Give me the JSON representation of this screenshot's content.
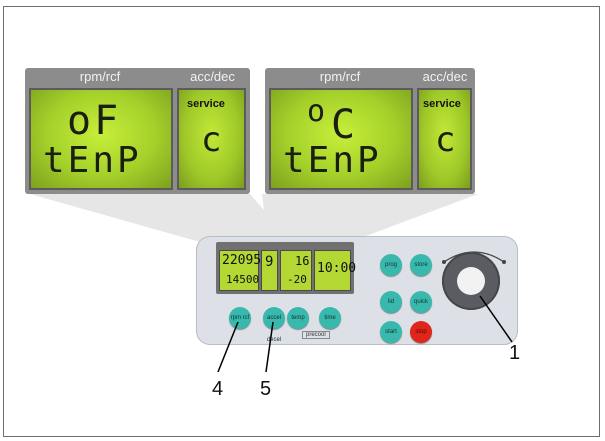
{
  "panel_left": {
    "header_main": "rpm/rcf",
    "header_side": "acc/dec",
    "line1": "oF",
    "line2": "tEnP",
    "side_label": "service",
    "side_value": "c"
  },
  "panel_right": {
    "header_main": "rpm/rcf",
    "header_side": "acc/dec",
    "line1_a": "o",
    "line1_b": "C",
    "line2": "tEnP",
    "side_label": "service",
    "side_value": "c"
  },
  "device": {
    "lcd": {
      "speed_top": "22095",
      "speed_bottom": "14500",
      "accdec": "9",
      "temp_top": "16",
      "temp_bottom": "-20",
      "time": "10:00"
    },
    "buttons": {
      "rpm_rcf": "rpm rcf",
      "accel_decel": "accel decel",
      "temp": "temp",
      "time": "time",
      "prog": "prog",
      "store": "store",
      "lid": "lid",
      "quick": "quick",
      "start": "start",
      "stop": "stop",
      "precool": "precool"
    }
  },
  "callouts": {
    "knob": "1",
    "rpm_button": "4",
    "accel_button": "5"
  },
  "colors": {
    "lcd_green": "#b4d833",
    "button_teal": "#39b9ad",
    "stop_red": "#e0261a",
    "panel_gray": "#8c8c8c"
  }
}
